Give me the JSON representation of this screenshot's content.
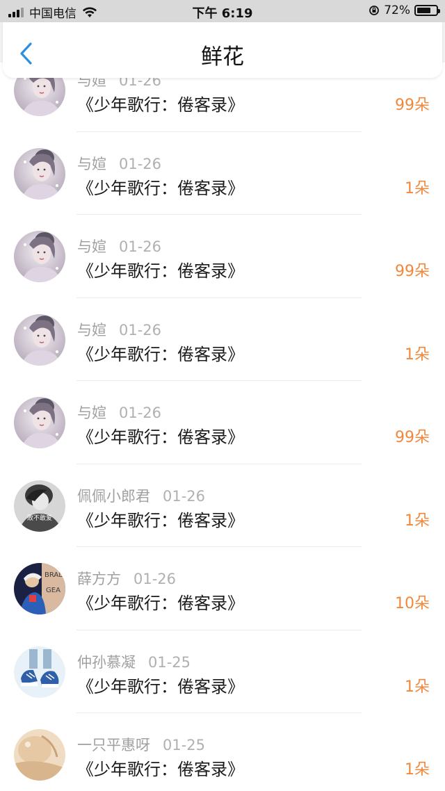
{
  "status_bar": {
    "carrier": "中国电信",
    "time": "下午 6:19",
    "battery": "72%",
    "battery_level": 0.72
  },
  "nav": {
    "title": "鲜花",
    "back_icon": "chevron-left-icon",
    "accent": "#2a8fe0"
  },
  "colors": {
    "amount": "#f0883c",
    "name": "#a0a0a0",
    "title": "#1a1a1a"
  },
  "items": [
    {
      "user": "与媗",
      "date": "01-26",
      "title": "《少年歌行：倦客录》",
      "amount": "99朵",
      "avatar": "avatar-girl"
    },
    {
      "user": "与媗",
      "date": "01-26",
      "title": "《少年歌行：倦客录》",
      "amount": "1朵",
      "avatar": "avatar-girl"
    },
    {
      "user": "与媗",
      "date": "01-26",
      "title": "《少年歌行：倦客录》",
      "amount": "99朵",
      "avatar": "avatar-girl"
    },
    {
      "user": "与媗",
      "date": "01-26",
      "title": "《少年歌行：倦客录》",
      "amount": "1朵",
      "avatar": "avatar-girl"
    },
    {
      "user": "与媗",
      "date": "01-26",
      "title": "《少年歌行：倦客录》",
      "amount": "99朵",
      "avatar": "avatar-girl"
    },
    {
      "user": "佩佩小郎君",
      "date": "01-26",
      "title": "《少年歌行：倦客录》",
      "amount": "1朵",
      "avatar": "avatar-bw"
    },
    {
      "user": "薛方方",
      "date": "01-26",
      "title": "《少年歌行：倦客录》",
      "amount": "10朵",
      "avatar": "avatar-color"
    },
    {
      "user": "仲孙慕凝",
      "date": "01-25",
      "title": "《少年歌行：倦客录》",
      "amount": "1朵",
      "avatar": "avatar-shoes"
    },
    {
      "user": "一只平惠呀",
      "date": "01-25",
      "title": "《少年歌行：倦客录》",
      "amount": "1朵",
      "avatar": "avatar-beige"
    }
  ]
}
